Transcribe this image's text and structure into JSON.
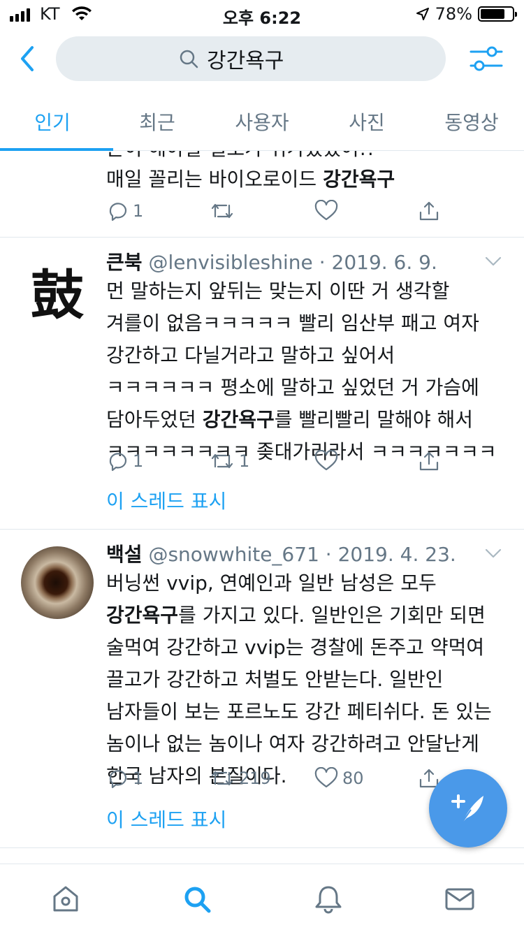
{
  "status": {
    "carrier": "KT",
    "time": "오후 6:22",
    "battery": "78%",
    "battery_level": 0.78
  },
  "search": {
    "query": "강간욕구"
  },
  "tabs": [
    {
      "label": "인기",
      "active": true
    },
    {
      "label": "최근",
      "active": false
    },
    {
      "label": "사용자",
      "active": false
    },
    {
      "label": "사진",
      "active": false
    },
    {
      "label": "동영상",
      "active": false
    }
  ],
  "tweets": [
    {
      "partial_top_line": "혼이 해야할 일로가 쉬가있었어!!",
      "line": "매일 꼴리는 바이오로이드 ",
      "highlight": "강간욕구",
      "reply_count": "1",
      "retweet_count": "",
      "like_count": ""
    },
    {
      "avatar_glyph": "鼓",
      "name": "큰북",
      "handle": "@lenvisibleshine",
      "date": "2019. 6. 9.",
      "text_before": "먼 말하는지 앞뒤는 맞는지 이딴 거 생각할 겨를이 없음ㅋㅋㅋㅋㅋ 빨리 임산부 패고 여자 강간하고 다닐거라고 말하고 싶어서 ㅋㅋㅋㅋㅋㅋ 평소에 말하고 싶었던 거 가슴에 담아두었던 ",
      "highlight": "강간욕구",
      "text_after": "를 빨리빨리 말해야 해서 ㅋㅋㅋㅋㅋㅋㅋㅋ 좆대가리라서 ㅋㅋㅋㅋㅋㅋㅋ",
      "reply_count": "1",
      "retweet_count": "1",
      "like_count": "",
      "thread_link": "이 스레드 표시"
    },
    {
      "name": "백설",
      "handle": "@snowwhite_671",
      "date": "2019. 4. 23.",
      "text_before": "버닝썬 vvip, 연예인과 일반 남성은 모두 ",
      "highlight": "강간욕구",
      "text_after": "를 가지고 있다. 일반인은 기회만 되면 술먹여 강간하고 vvip는 경찰에 돈주고 약먹여 끌고가 강간하고 처벌도 안받는다. 일반인 남자들이 보는 포르노도 강간 페티쉬다. 돈 있는 놈이나 없는 놈이나 여자 강간하려고 안달난게 한국 남자의 본질이다.",
      "reply_count": "1",
      "retweet_count": "219",
      "like_count": "80",
      "thread_link": "이 스레드 표시"
    }
  ],
  "colors": {
    "accent": "#1da1f2",
    "muted": "#657786",
    "search_bg": "#e6ecf0",
    "fab": "#4a99e9"
  },
  "icons": {
    "status": [
      "signal-icon",
      "wifi-icon",
      "location-arrow-icon",
      "battery-icon"
    ],
    "header": [
      "back-chevron-icon",
      "search-icon",
      "filter-sliders-icon"
    ],
    "actions": [
      "reply-icon",
      "retweet-icon",
      "like-heart-icon",
      "share-icon"
    ],
    "nav": [
      "home-icon",
      "search-icon",
      "notifications-bell-icon",
      "messages-envelope-icon"
    ]
  }
}
